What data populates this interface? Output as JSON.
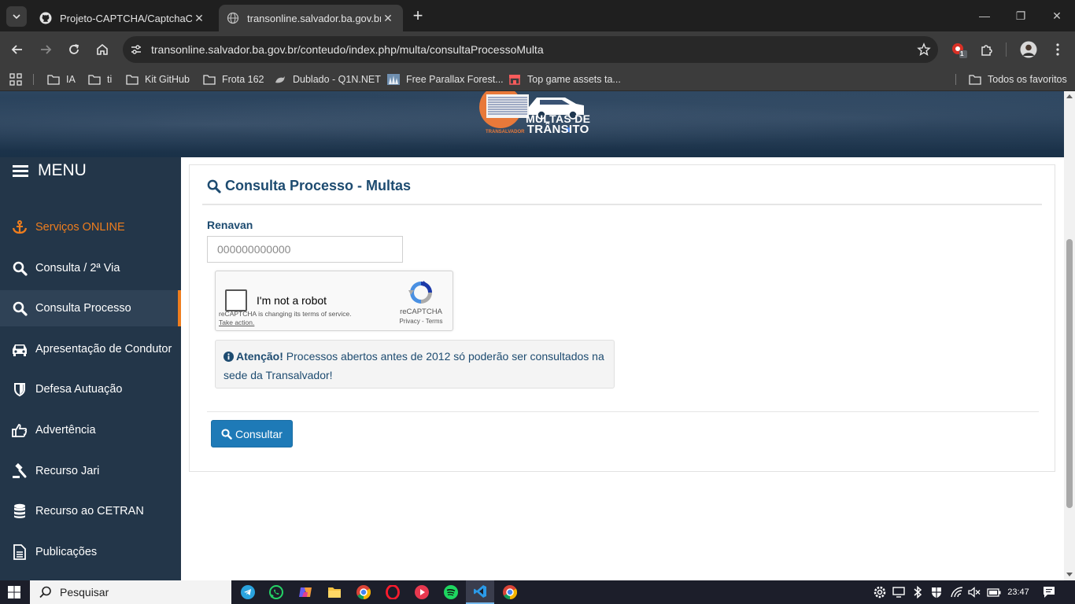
{
  "browser": {
    "tabs": [
      {
        "title": "Projeto-CAPTCHA/CaptchaClick",
        "active": false
      },
      {
        "title": "transonline.salvador.ba.gov.br/c",
        "active": true
      }
    ],
    "close_glyph": "✕",
    "new_tab_glyph": "+",
    "url": "transonline.salvador.ba.gov.br/conteudo/index.php/multa/consultaProcessoMulta",
    "extension_badge": "1",
    "window_controls": {
      "minimize": "—",
      "restore": "❐",
      "close": "✕"
    },
    "bookmarks": [
      "IA",
      "ti",
      "Kit GitHub",
      "Frota 162",
      "Dublado - Q1N.NET",
      "Free Parallax Forest...",
      "Top game assets ta..."
    ],
    "all_bookmarks": "Todos os favoritos"
  },
  "banner": {
    "logo_line1": "MULTAS DE",
    "logo_line2": "TRÂNSITO",
    "logo_sub": "TRANSALVADOR"
  },
  "sidebar": {
    "menu_label": "MENU",
    "items": [
      {
        "label": "Serviços ONLINE",
        "icon": "anchor-icon"
      },
      {
        "label": "Consulta / 2ª Via",
        "icon": "search-icon"
      },
      {
        "label": "Consulta Processo",
        "icon": "search-icon"
      },
      {
        "label": "Apresentação de Condutor",
        "icon": "car-icon"
      },
      {
        "label": "Defesa Autuação",
        "icon": "shield-icon"
      },
      {
        "label": "Advertência",
        "icon": "thumbs-up-icon"
      },
      {
        "label": "Recurso Jari",
        "icon": "gavel-icon"
      },
      {
        "label": "Recurso ao CETRAN",
        "icon": "database-icon"
      },
      {
        "label": "Publicações",
        "icon": "document-icon"
      }
    ]
  },
  "main": {
    "title": "Consulta Processo - Multas",
    "field_label": "Renavan",
    "renavan_placeholder": "000000000000",
    "recaptcha": {
      "label": "I'm not a robot",
      "notice": "reCAPTCHA is changing its terms of service.",
      "take_action": "Take action.",
      "brand": "reCAPTCHA",
      "links": "Privacy - Terms"
    },
    "alert": {
      "strong": "Atenção!",
      "text": " Processos abertos antes de 2012 só poderão ser consultados na sede da Transalvador!"
    },
    "submit_label": "Consultar"
  },
  "taskbar": {
    "search_label": "Pesquisar",
    "time": "23:47"
  },
  "colors": {
    "sidebar_bg": "#233649",
    "accent_orange": "#ef7d1d",
    "title_blue": "#1d4b70",
    "button_blue": "#1e7ab7"
  }
}
